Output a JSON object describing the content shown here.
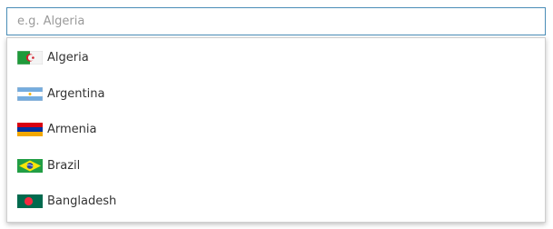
{
  "search": {
    "placeholder": "e.g. Algeria",
    "value": ""
  },
  "options": [
    {
      "label": "Algeria",
      "flag_icon": "algeria-flag-icon"
    },
    {
      "label": "Argentina",
      "flag_icon": "argentina-flag-icon"
    },
    {
      "label": "Armenia",
      "flag_icon": "armenia-flag-icon"
    },
    {
      "label": "Brazil",
      "flag_icon": "brazil-flag-icon"
    },
    {
      "label": "Bangladesh",
      "flag_icon": "bangladesh-flag-icon"
    }
  ],
  "colors": {
    "input_border": "#4a8db7",
    "placeholder": "#9a9a9a",
    "text": "#333333",
    "dropdown_border": "#cfcfcf"
  }
}
